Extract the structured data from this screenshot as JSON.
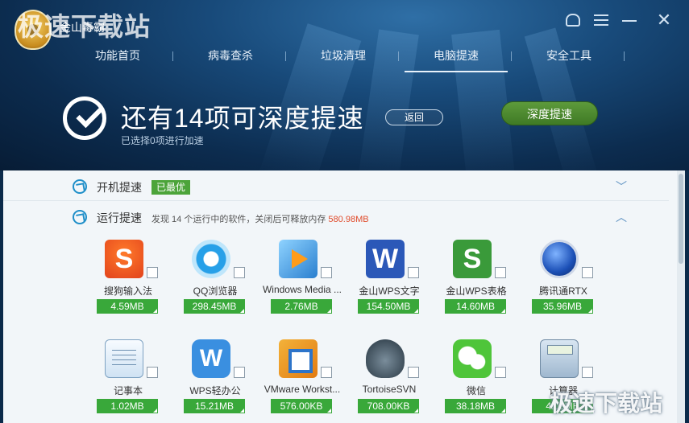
{
  "window": {
    "app_name": "金山毒霸",
    "watermark_top": "极速下载站",
    "watermark_bottom": "极速下载站"
  },
  "nav": {
    "items": [
      "功能首页",
      "病毒查杀",
      "垃圾清理",
      "电脑提速",
      "安全工具"
    ],
    "active_index": 3
  },
  "hero": {
    "title": "还有14项可深度提速",
    "subtitle": "已选择0项进行加速",
    "back_label": "返回",
    "deep_label": "深度提速"
  },
  "boot_row": {
    "label": "开机提速",
    "badge": "已最优"
  },
  "running_row": {
    "label": "运行提速",
    "desc_prefix": "发现 14 个运行中的软件，关闭后可释放内存",
    "desc_mem": "580.98MB"
  },
  "apps": [
    {
      "name": "搜狗输入法",
      "mem": "4.59MB",
      "icon": "sogou-icon"
    },
    {
      "name": "QQ浏览器",
      "mem": "298.45MB",
      "icon": "qq-browser-icon"
    },
    {
      "name": "Windows Media ...",
      "mem": "2.76MB",
      "icon": "windows-media-icon"
    },
    {
      "name": "金山WPS文字",
      "mem": "154.50MB",
      "icon": "wps-writer-icon"
    },
    {
      "name": "金山WPS表格",
      "mem": "14.60MB",
      "icon": "wps-spreadsheet-icon"
    },
    {
      "name": "腾讯通RTX",
      "mem": "35.96MB",
      "icon": "rtx-icon"
    },
    {
      "name": "记事本",
      "mem": "1.02MB",
      "icon": "notepad-icon"
    },
    {
      "name": "WPS轻办公",
      "mem": "15.21MB",
      "icon": "wps-light-icon"
    },
    {
      "name": "VMware Workst...",
      "mem": "576.00KB",
      "icon": "vmware-icon"
    },
    {
      "name": "TortoiseSVN",
      "mem": "708.00KB",
      "icon": "tortoisesvn-icon"
    },
    {
      "name": "微信",
      "mem": "38.18MB",
      "icon": "wechat-icon"
    },
    {
      "name": "计算器",
      "mem": "4.03MB",
      "icon": "calculator-icon"
    }
  ]
}
